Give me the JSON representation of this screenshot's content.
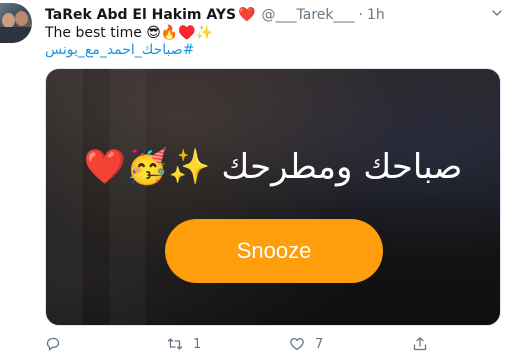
{
  "tweet": {
    "author_name": "TaRek Abd El Hakim AYS",
    "name_emoji": "❤️",
    "handle": "@___Tarek___",
    "separator": "·",
    "time": "1h",
    "text": "The best time 😎🔥♥️✨",
    "hashtag": "#صباحك_احمد_مع_يونس"
  },
  "media": {
    "caption": "صباحك ومطرحك ✨🥳❤️",
    "button_label": "Snooze",
    "button_color": "#ff9e0d"
  },
  "actions": {
    "reply_count": "",
    "retweet_count": "1",
    "like_count": "7"
  },
  "icons": {
    "more": "chevron-down-icon",
    "reply": "reply-icon",
    "retweet": "retweet-icon",
    "like": "heart-icon",
    "share": "share-icon"
  }
}
